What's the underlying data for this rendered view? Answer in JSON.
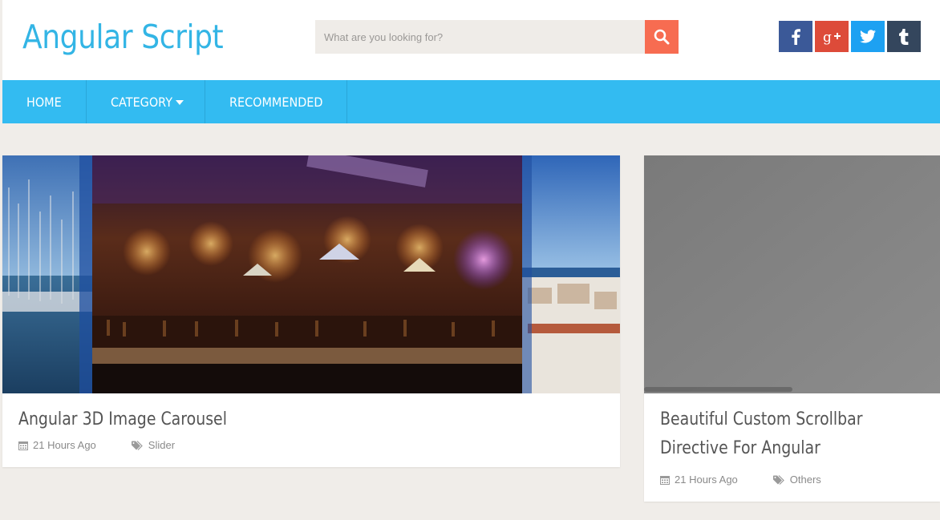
{
  "header": {
    "logo": "Angular Script",
    "search": {
      "placeholder": "What are you looking for?"
    },
    "social": [
      "facebook-icon",
      "google-plus-icon",
      "twitter-icon",
      "tumblr-icon"
    ]
  },
  "nav": {
    "items": [
      {
        "label": "HOME"
      },
      {
        "label": "CATEGORY"
      },
      {
        "label": "RECOMMENDED"
      }
    ]
  },
  "posts": [
    {
      "title": "Angular 3D Image Carousel",
      "date": "21 Hours Ago",
      "tag": "Slider"
    },
    {
      "title_line1": "Beautiful Custom Scrollbar",
      "title_line2": "Directive For Angular",
      "date": "21 Hours Ago",
      "tag": "Others"
    }
  ],
  "colors": {
    "brand": "#33b5e5",
    "nav_bg": "#33bbf1",
    "search_button": "#f76c51",
    "facebook": "#3b5998",
    "google_plus": "#dd4b39",
    "twitter": "#1da1f2",
    "tumblr": "#34465d",
    "page_bg": "#f0ede9"
  }
}
